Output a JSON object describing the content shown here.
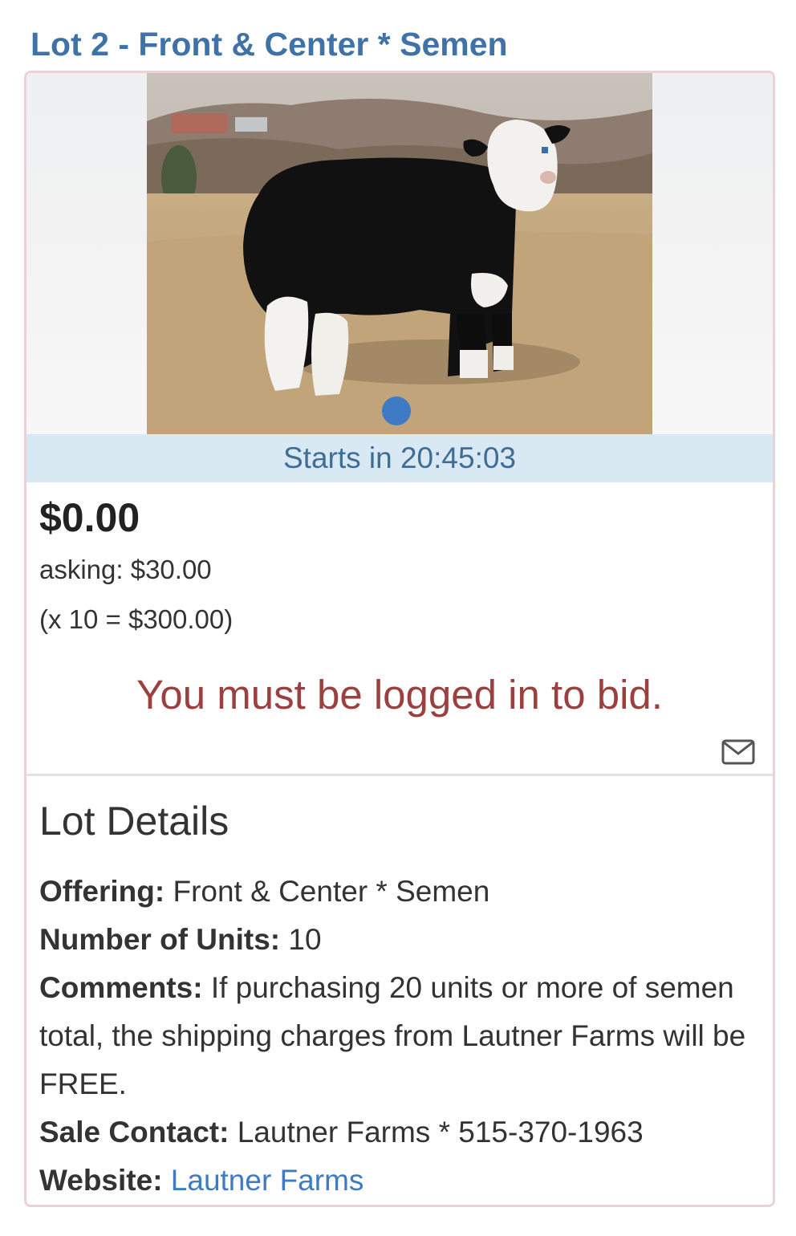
{
  "lot": {
    "title": "Lot 2 - Front & Center * Semen"
  },
  "image": {
    "alt": "Front & Center calf photo"
  },
  "timer": {
    "text": "Starts in 20:45:03"
  },
  "bid": {
    "current_price": "$0.00",
    "asking": "asking: $30.00",
    "multiplier": "(x 10 = $300.00)",
    "login_message": "You must be logged in to bid."
  },
  "icons": {
    "mail": "envelope-icon"
  },
  "details": {
    "heading": "Lot Details",
    "offering_label": "Offering:",
    "offering_value": "Front & Center * Semen",
    "units_label": "Number of Units:",
    "units_value": "10",
    "comments_label": "Comments:",
    "comments_value": "If purchasing 20 units or more of semen total, the shipping charges from Lautner Farms will be FREE.",
    "contact_label": "Sale Contact:",
    "contact_value": "Lautner Farms * 515-370-1963",
    "website_label": "Website:",
    "website_link": "Lautner Farms"
  },
  "colors": {
    "title_blue": "#3f73a8",
    "timer_bg": "#d9e9f4",
    "login_red": "#9c3f3f",
    "link_blue": "#3f7bc4",
    "card_border": "#ead3d7"
  }
}
